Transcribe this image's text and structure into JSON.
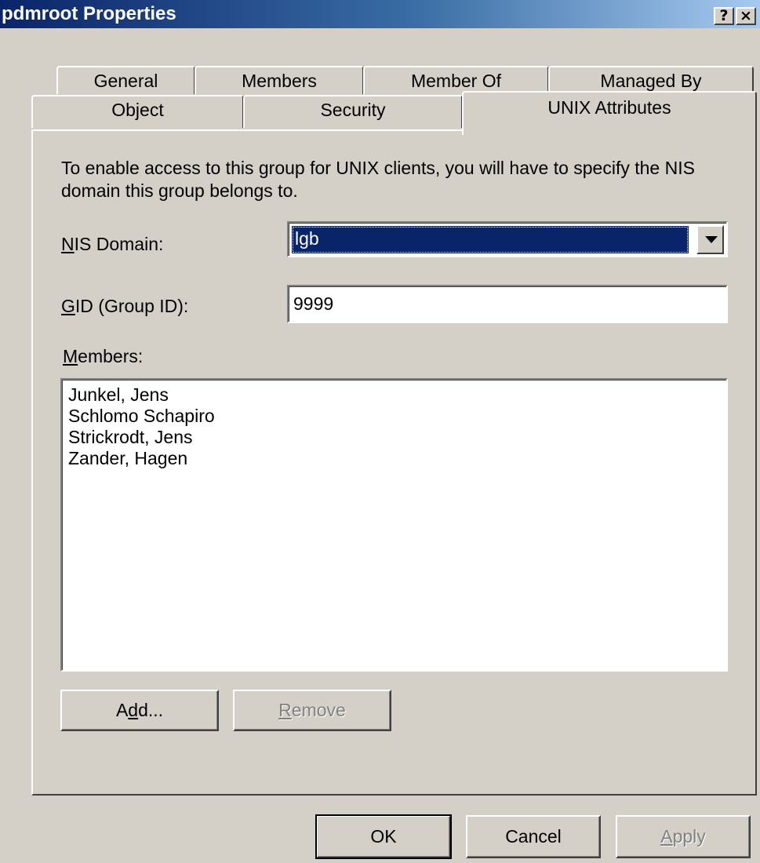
{
  "window": {
    "title": "pdmroot Properties",
    "help_button": "?",
    "close_button": "×"
  },
  "tabs": {
    "row1": [
      "General",
      "Members",
      "Member Of",
      "Managed By"
    ],
    "row2": [
      "Object",
      "Security",
      "UNIX Attributes"
    ],
    "selected": "UNIX Attributes"
  },
  "content": {
    "intro": "To enable access to this group for UNIX clients, you will have to specify the NIS domain this group belongs to.",
    "nis_domain": {
      "label_access_key": "N",
      "label_rest": "IS Domain:",
      "value": "lgb"
    },
    "gid": {
      "label_access_key": "G",
      "label_rest": "ID (Group ID):",
      "value": "9999"
    },
    "members": {
      "label_access_key": "M",
      "label_rest": "embers:",
      "items": [
        "Junkel, Jens",
        "Schlomo Schapiro",
        "Strickrodt, Jens",
        "Zander, Hagen"
      ]
    },
    "add_button": {
      "pre": "A",
      "key": "d",
      "post": "d..."
    },
    "remove_button": {
      "key": "R",
      "post": "emove",
      "enabled": false
    }
  },
  "footer": {
    "ok_label": "OK",
    "cancel_label": "Cancel",
    "apply": {
      "key": "A",
      "post": "pply",
      "enabled": false
    }
  },
  "colors": {
    "window_bg": "#d4d0c8",
    "title_gradient_start": "#0a246a",
    "title_gradient_end": "#a6caf0",
    "selection": "#0a246a",
    "disabled_text": "#808080"
  }
}
